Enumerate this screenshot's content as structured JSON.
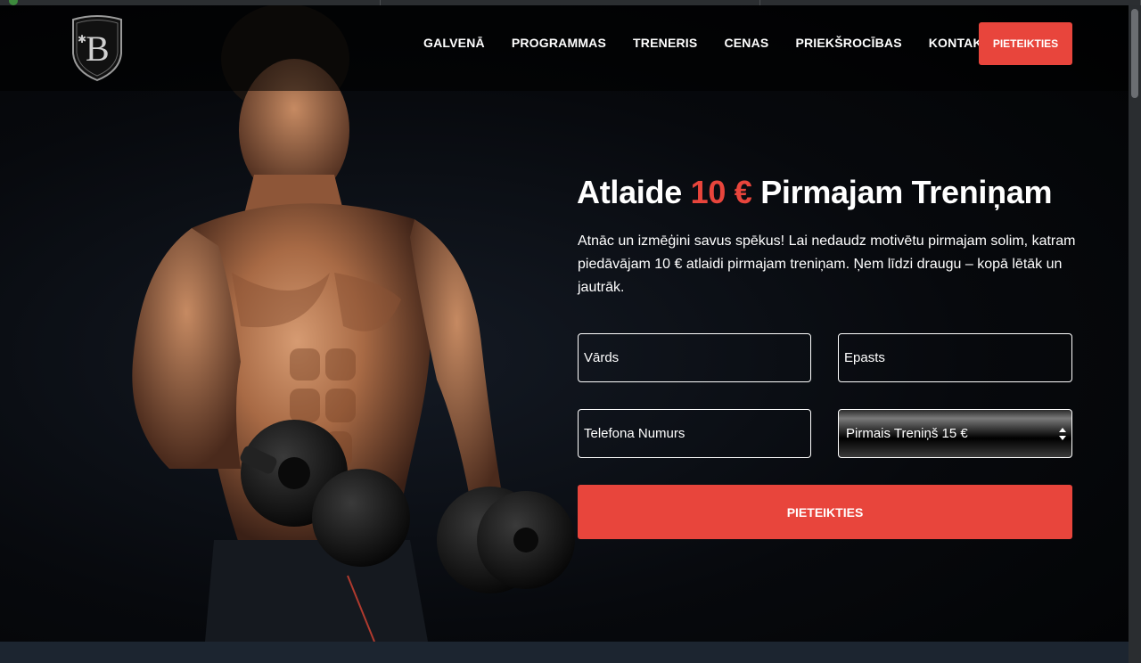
{
  "nav": {
    "items": [
      {
        "label": "GALVENĀ"
      },
      {
        "label": "PROGRAMMAS"
      },
      {
        "label": "TRENERIS"
      },
      {
        "label": "CENAS"
      },
      {
        "label": "PRIEKŠROCĪBAS"
      },
      {
        "label": "KONTAKTI"
      }
    ],
    "cta_label": "PIETEIKTIES"
  },
  "hero": {
    "headline_before": "Atlaide ",
    "headline_accent": "10 €",
    "headline_after": " Pirmajam Treniņam",
    "lead": "Atnāc un izmēģini savus spēkus! Lai nedaudz motivētu pirmajam solim, katram piedāvājam 10 € atlaidi pirmajam treniņam. Ņem līdzi draugu – kopā lētāk un jautrāk."
  },
  "form": {
    "name_placeholder": "Vārds",
    "email_placeholder": "Epasts",
    "phone_placeholder": "Telefona Numurs",
    "select_value": "Pirmais Treniņš 15 €",
    "submit_label": "PIETEIKTIES"
  },
  "colors": {
    "accent": "#e8453c",
    "background": "#05070a",
    "footer_band": "#1c2530"
  },
  "icons": {
    "logo": "shield-b-logo",
    "select_arrows": "updown-arrows-icon"
  }
}
